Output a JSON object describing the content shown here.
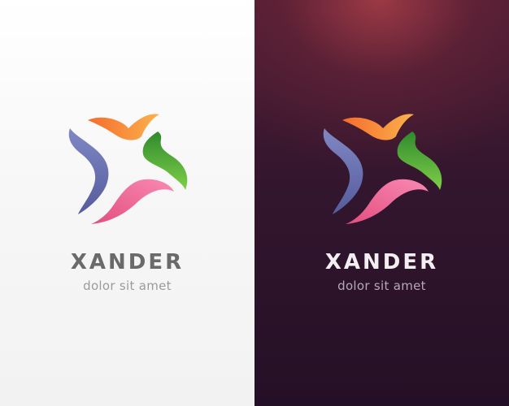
{
  "brand": {
    "name": "XANDER",
    "tagline": "dolor sit amet"
  },
  "logo": {
    "icon": "star-ribbon-icon",
    "colors": {
      "orange": "#f7993e",
      "green": "#5dba3e",
      "pink": "#ee5f93",
      "blue": "#6c73b0"
    }
  },
  "panels": {
    "light": {
      "background": "#f5f5f5",
      "text_color": "#6a6a6a"
    },
    "dark": {
      "background": "#2e1430",
      "text_color": "#f2eef2"
    }
  }
}
